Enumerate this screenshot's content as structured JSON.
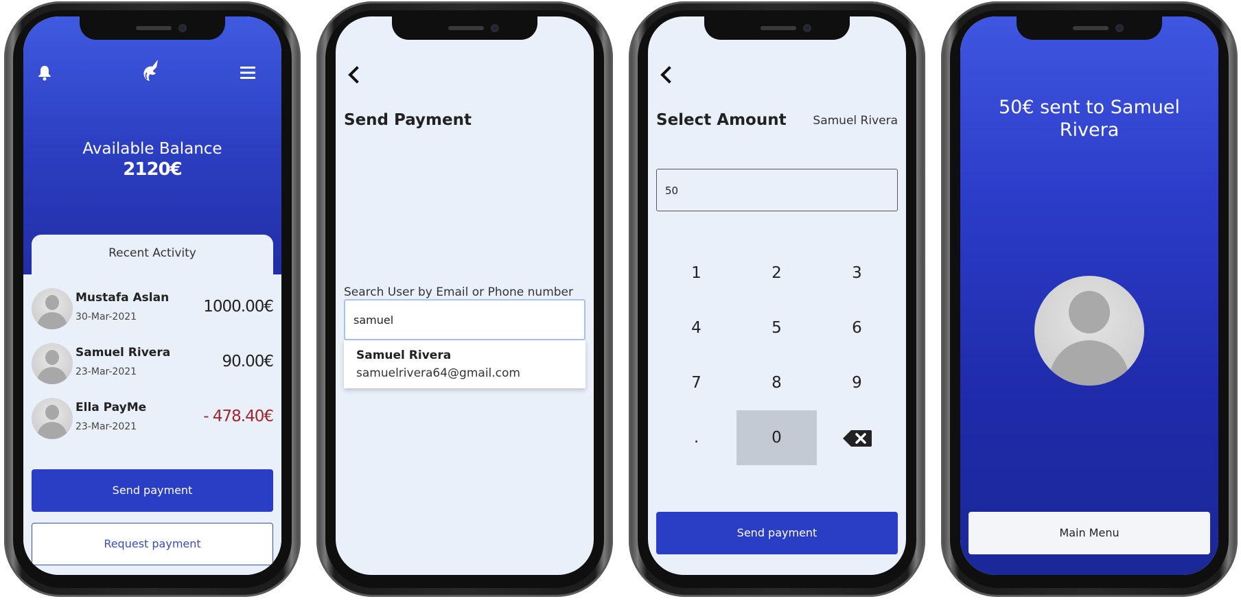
{
  "screen1": {
    "balance_label": "Available Balance",
    "balance_value": "2120€",
    "recent_activity": "Recent Activity",
    "transactions": [
      {
        "name": "Mustafa Aslan",
        "date": "30-Mar-2021",
        "amount": "1000.00€",
        "negative": false
      },
      {
        "name": "Samuel Rivera",
        "date": "23-Mar-2021",
        "amount": "90.00€",
        "negative": false
      },
      {
        "name": "Ella PayMe",
        "date": "23-Mar-2021",
        "amount": "- 478.40€",
        "negative": true
      }
    ],
    "send_payment": "Send payment",
    "request_payment": "Request payment"
  },
  "screen2": {
    "title": "Send Payment",
    "search_label": "Search User by Email or Phone number",
    "search_value": "samuel",
    "suggestion": {
      "name": "Samuel Rivera",
      "email": "samuelrivera64@gmail.com"
    }
  },
  "screen3": {
    "title": "Select Amount",
    "recipient": "Samuel Rivera",
    "amount_value": "50",
    "keys": [
      "1",
      "2",
      "3",
      "4",
      "5",
      "6",
      "7",
      "8",
      "9",
      ".",
      "0"
    ],
    "send_payment": "Send payment"
  },
  "screen4": {
    "confirmation": "50€ sent to Samuel Rivera",
    "main_menu": "Main Menu"
  },
  "colors": {
    "accent_blue": "#2a3dc5",
    "negative_red": "#a0262d",
    "screen_bg": "#eaf0f9"
  }
}
